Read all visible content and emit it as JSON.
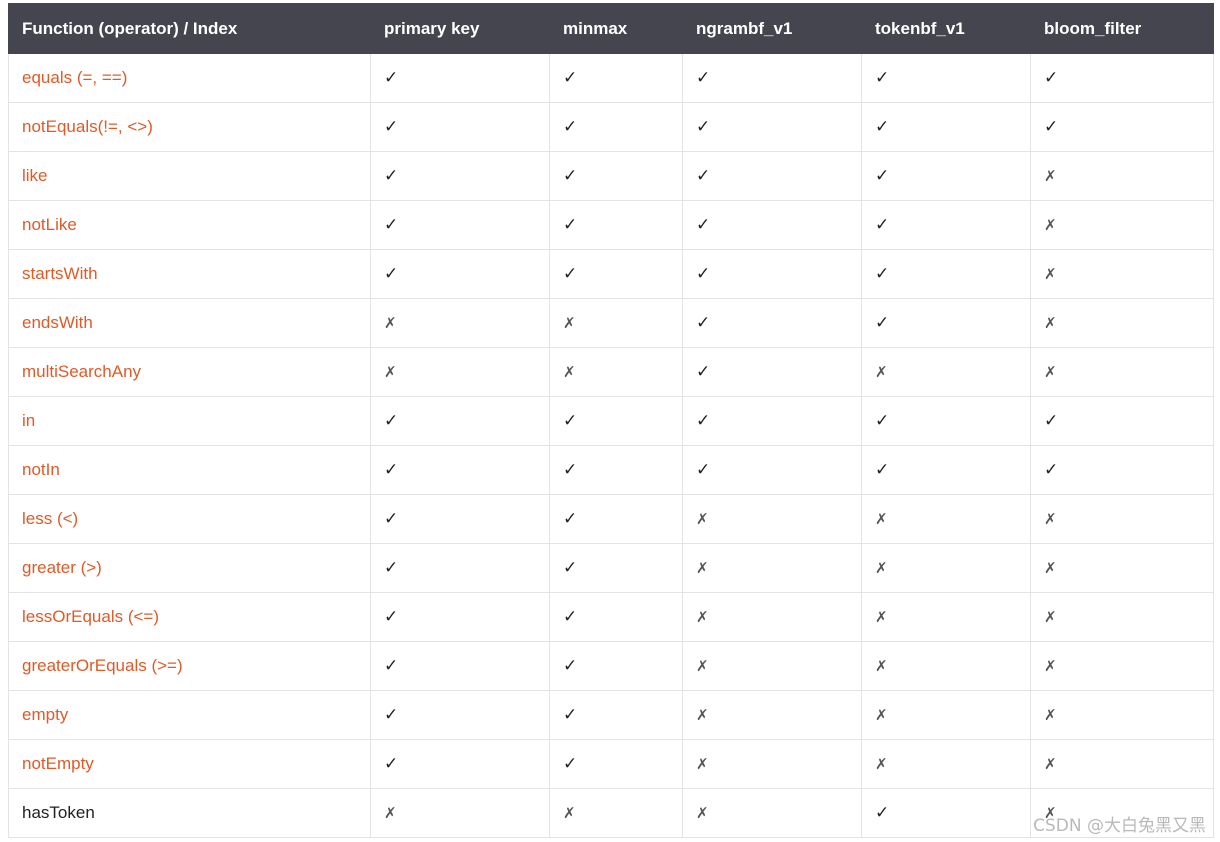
{
  "table": {
    "headers": [
      "Function (operator) / Index",
      "primary key",
      "minmax",
      "ngrambf_v1",
      "tokenbf_v1",
      "bloom_filter"
    ],
    "rows": [
      {
        "function": "equals (=, ==)",
        "link": true,
        "support": [
          "✓",
          "✓",
          "✓",
          "✓",
          "✓"
        ]
      },
      {
        "function": "notEquals(!=, <>)",
        "link": true,
        "support": [
          "✓",
          "✓",
          "✓",
          "✓",
          "✓"
        ]
      },
      {
        "function": "like",
        "link": true,
        "support": [
          "✓",
          "✓",
          "✓",
          "✓",
          "✗"
        ]
      },
      {
        "function": "notLike",
        "link": true,
        "support": [
          "✓",
          "✓",
          "✓",
          "✓",
          "✗"
        ]
      },
      {
        "function": "startsWith",
        "link": true,
        "support": [
          "✓",
          "✓",
          "✓",
          "✓",
          "✗"
        ]
      },
      {
        "function": "endsWith",
        "link": true,
        "support": [
          "✗",
          "✗",
          "✓",
          "✓",
          "✗"
        ]
      },
      {
        "function": "multiSearchAny",
        "link": true,
        "support": [
          "✗",
          "✗",
          "✓",
          "✗",
          "✗"
        ]
      },
      {
        "function": "in",
        "link": true,
        "support": [
          "✓",
          "✓",
          "✓",
          "✓",
          "✓"
        ]
      },
      {
        "function": "notIn",
        "link": true,
        "support": [
          "✓",
          "✓",
          "✓",
          "✓",
          "✓"
        ]
      },
      {
        "function": "less (<)",
        "link": true,
        "support": [
          "✓",
          "✓",
          "✗",
          "✗",
          "✗"
        ]
      },
      {
        "function": "greater (>)",
        "link": true,
        "support": [
          "✓",
          "✓",
          "✗",
          "✗",
          "✗"
        ]
      },
      {
        "function": "lessOrEquals (<=)",
        "link": true,
        "support": [
          "✓",
          "✓",
          "✗",
          "✗",
          "✗"
        ]
      },
      {
        "function": "greaterOrEquals (>=)",
        "link": true,
        "support": [
          "✓",
          "✓",
          "✗",
          "✗",
          "✗"
        ]
      },
      {
        "function": "empty",
        "link": true,
        "support": [
          "✓",
          "✓",
          "✗",
          "✗",
          "✗"
        ]
      },
      {
        "function": "notEmpty",
        "link": true,
        "support": [
          "✓",
          "✓",
          "✗",
          "✗",
          "✗"
        ]
      },
      {
        "function": "hasToken",
        "link": false,
        "support": [
          "✗",
          "✗",
          "✗",
          "✓",
          "✗"
        ]
      }
    ]
  },
  "colors": {
    "header_bg": "#454550",
    "link": "#e05a28",
    "border": "#e3e3e3"
  },
  "watermark": "CSDN @大白兔黑又黑"
}
